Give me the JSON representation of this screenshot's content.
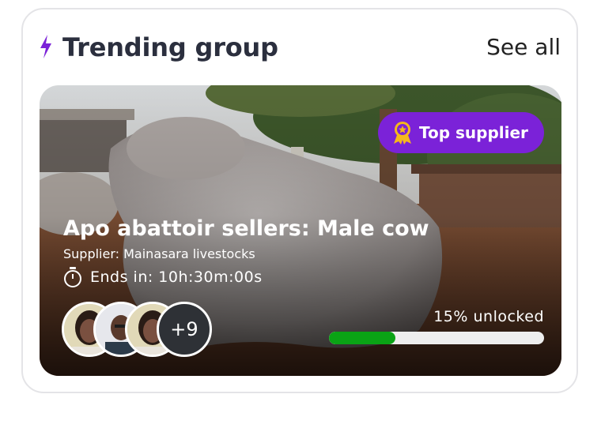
{
  "header": {
    "title": "Trending group",
    "see_all": "See all"
  },
  "group": {
    "badge": "Top supplier",
    "title": "Apo abattoir sellers: Male cow",
    "supplier": "Supplier: Mainasara livestocks",
    "ends_in": "Ends in: 10h:30m:00s",
    "extra_members": "+9",
    "progress_label": "15% unlocked",
    "progress_fraction": 0.31
  },
  "colors": {
    "accent": "#7b22d8",
    "progress": "#0aa315",
    "title": "#2b2f3e"
  },
  "icons": [
    "lightning-icon",
    "medal-icon",
    "timer-icon"
  ]
}
